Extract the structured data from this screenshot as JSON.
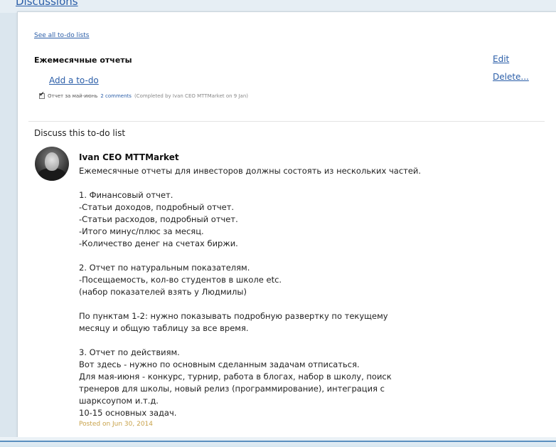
{
  "top_link": "Discussions",
  "see_all": "See all to-do lists",
  "list": {
    "title": "Ежемесячные отчеты",
    "add_todo": "Add a to-do",
    "edit": "Edit",
    "delete": "Delete..."
  },
  "todo": {
    "text": "Отчет за май-июнь",
    "comments": "2 comments",
    "completed": "(Completed by Ivan CEO MTTMarket on 9 Jan)",
    "checked": true
  },
  "discussion": {
    "heading": "Discuss this to-do list",
    "author": "Ivan CEO MTTMarket",
    "lines": [
      "Ежемесячные отчеты для инвесторов должны состоять из нескольких частей.",
      "",
      "1. Финансовый отчет.",
      "-Статьи доходов, подробный отчет.",
      "-Статьи расходов, подробный отчет.",
      "-Итого минус/плюс за месяц.",
      "-Количество денег на счетах биржи.",
      "",
      "2. Отчет по натуральным показателям.",
      "-Посещаемость, кол-во студентов в школе etc.",
      "(набор показателей взять у Людмилы)",
      "",
      "По пунктам 1-2: нужно показывать подробную развертку по текущему",
      "месяцу и общую таблицу за все время.",
      "",
      "3. Отчет по действиям.",
      "Вот здесь - нужно по основным сделанным задачам отписаться.",
      "Для мая-июня - конкурс, турнир, работа в блогах, набор в школу, поиск",
      "тренеров для школы, новый релиз (программирование), интеграция с",
      "шарксоупом и.т.д.",
      "10-15 основных задач."
    ],
    "posted": "Posted on Jun 30, 2014"
  }
}
